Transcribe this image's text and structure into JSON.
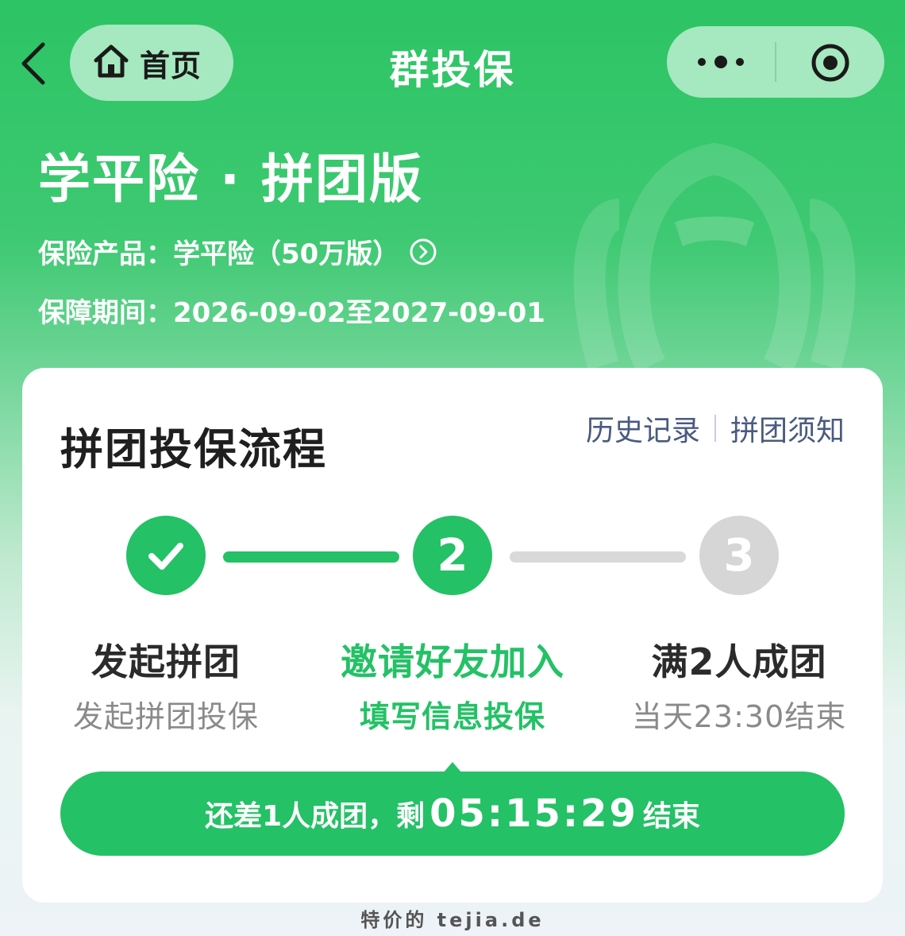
{
  "nav": {
    "home_label": "首页",
    "title": "群投保"
  },
  "header": {
    "product_title": "学平险 · 拼团版",
    "product_label": "保险产品：",
    "product_value": "学平险（50万版）",
    "period_label": "保障期间：",
    "period_value": "2026-09-02至2027-09-01"
  },
  "card": {
    "title": "拼团投保流程",
    "link_history": "历史记录",
    "link_notice": "拼团须知",
    "steps": [
      {
        "number": "✓",
        "label": "发起拼团",
        "sub": "发起拼团投保",
        "state": "done"
      },
      {
        "number": "2",
        "label": "邀请好友加入",
        "sub": "填写信息投保",
        "state": "active"
      },
      {
        "number": "3",
        "label": "满2人成团",
        "sub": "当天23:30结束",
        "state": "todo"
      }
    ],
    "countdown_prefix": "还差1人成团，剩",
    "countdown_time": "05:15:29",
    "countdown_suffix": "结束"
  },
  "footer": {
    "watermark": "特价的 tejia.de"
  },
  "colors": {
    "accent": "#24c166",
    "header_bg": "#2cc464",
    "link": "#4a5a80"
  }
}
